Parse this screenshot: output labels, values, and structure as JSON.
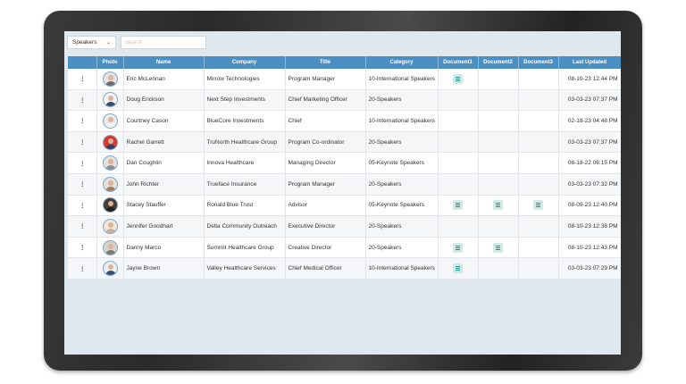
{
  "toolbar": {
    "list_select_value": "Speakers",
    "search_placeholder": "Search"
  },
  "table": {
    "headers": {
      "photo": "Photo",
      "name": "Name",
      "company": "Company",
      "title": "Title",
      "category": "Category",
      "doc1": "Document1",
      "doc2": "Document2",
      "doc3": "Document3",
      "updated": "Last Updated"
    },
    "rows": [
      {
        "name": "Eric McLennan",
        "company": "Mirrow Technologies",
        "title": "Program Manager",
        "category": "10-International Speakers",
        "docs": [
          true,
          false,
          false
        ],
        "updated": "08-10-23 12:44 PM",
        "avatar_shirt": "#6b6b6b",
        "avatar_bg": "#e9e2dc"
      },
      {
        "name": "Doug Erickson",
        "company": "Next Step Investments",
        "title": "Chief Marketing Officer",
        "category": "20-Speakers",
        "docs": [
          false,
          false,
          false
        ],
        "updated": "03-03-23 07:37 PM",
        "avatar_shirt": "#3b4b6b",
        "avatar_bg": "#f3f3f3"
      },
      {
        "name": "Courtney Cason",
        "company": "BlueCore Investments",
        "title": "Chief",
        "category": "10-International Speakers",
        "docs": [
          false,
          false,
          false
        ],
        "updated": "02-18-23 04:48 PM",
        "avatar_shirt": "#f2f2f2",
        "avatar_bg": "#ececec"
      },
      {
        "name": "Rachel Garrett",
        "company": "TruNorth Healthcare Group",
        "title": "Program Co-ordinator",
        "category": "20-Speakers",
        "docs": [
          false,
          false,
          false
        ],
        "updated": "03-03-23 07:37 PM",
        "avatar_shirt": "#2c3f6e",
        "avatar_bg": "#d8382f"
      },
      {
        "name": "Dan Coughlin",
        "company": "Innova Healthcare",
        "title": "Managing Director",
        "category": "05-Keynote Speakers",
        "docs": [
          false,
          false,
          false
        ],
        "updated": "08-18-22 06:15 PM",
        "avatar_shirt": "#8d8d8d",
        "avatar_bg": "#e6e1db"
      },
      {
        "name": "John Richter",
        "company": "Trueface Insurance",
        "title": "Program Manager",
        "category": "20-Speakers",
        "docs": [
          false,
          false,
          false
        ],
        "updated": "03-03-23 07:32 PM",
        "avatar_shirt": "#a07a5c",
        "avatar_bg": "#e9e0d5"
      },
      {
        "name": "Stacey Stauffer",
        "company": "Ronald Blue Trust",
        "title": "Advisor",
        "category": "05-Keynote Speakers",
        "docs": [
          true,
          true,
          true
        ],
        "updated": "08-09-23 12:40 PM",
        "avatar_shirt": "#1f1f1f",
        "avatar_bg": "#4a3b35"
      },
      {
        "name": "Jennifer Goodhart",
        "company": "Delta Community Outreach",
        "title": "Executive Director",
        "category": "20-Speakers",
        "docs": [
          false,
          false,
          false
        ],
        "updated": "08-10-23 12:38 PM",
        "avatar_shirt": "#c9b49a",
        "avatar_bg": "#efe6dc"
      },
      {
        "name": "Danny Marco",
        "company": "Summit Healthcare Group",
        "title": "Creative Director",
        "category": "20-Speakers",
        "docs": [
          true,
          true,
          false
        ],
        "updated": "08-10-23 12:43 PM",
        "avatar_shirt": "#7a7a7a",
        "avatar_bg": "#d9d2c9"
      },
      {
        "name": "Jayne Brown",
        "company": "Valley Healthcare Services",
        "title": "Chief Medical Officer",
        "category": "10-International Speakers",
        "docs": [
          true,
          false,
          false
        ],
        "updated": "03-03-23 07:29 PM",
        "avatar_shirt": "#3a4a70",
        "avatar_bg": "#eeeeee"
      }
    ]
  },
  "icons": {
    "row_menu": "vertical-dots-icon",
    "document": "document-icon",
    "select_chevron": "chevron-down-icon"
  },
  "colors": {
    "header_bg": "#4a8ec2",
    "name_link": "#3d86c6",
    "doc_icon_bg": "#cfe9e6",
    "screen_bg": "#dfe8ef"
  }
}
